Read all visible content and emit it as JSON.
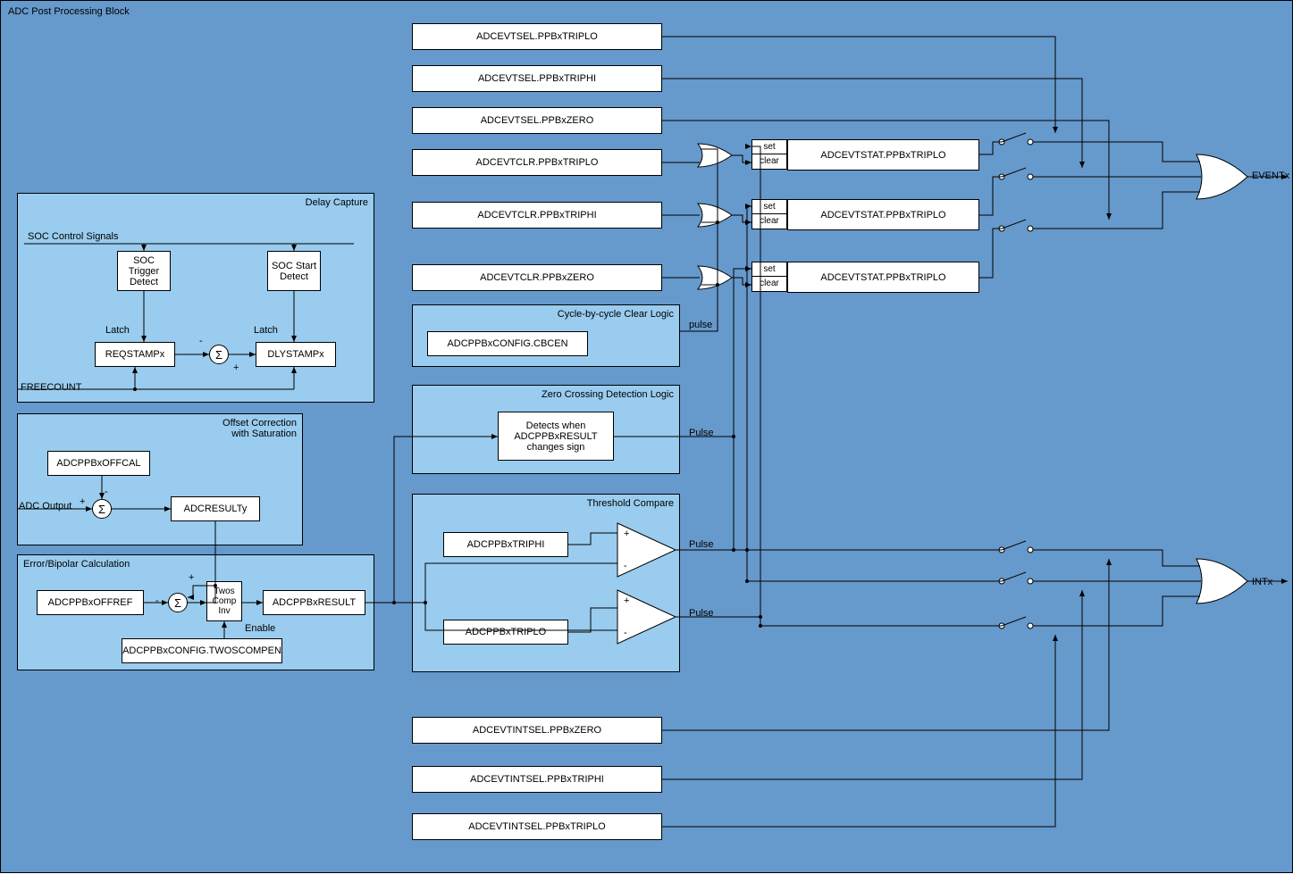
{
  "title": "ADC Post Processing Block",
  "registers": {
    "evtsel_triplo": "ADCEVTSEL.PPBxTRIPLO",
    "evtsel_triphi": "ADCEVTSEL.PPBxTRIPHI",
    "evtsel_zero": "ADCEVTSEL.PPBxZERO",
    "evtclr_triplo": "ADCEVTCLR.PPBxTRIPLO",
    "evtclr_triphi": "ADCEVTCLR.PPBxTRIPHI",
    "evtclr_zero": "ADCEVTCLR.PPBxZERO",
    "evtstat1": "ADCEVTSTAT.PPBxTRIPLO",
    "evtstat2": "ADCEVTSTAT.PPBxTRIPLO",
    "evtstat3": "ADCEVTSTAT.PPBxTRIPLO",
    "cbcen": "ADCPPBxCONFIG.CBCEN",
    "evtintsel_zero": "ADCEVTINTSEL.PPBxZERO",
    "evtintsel_triphi": "ADCEVTINTSEL.PPBxTRIPHI",
    "evtintsel_triplo": "ADCEVTINTSEL.PPBxTRIPLO"
  },
  "delay_capture": {
    "title": "Delay Capture",
    "soc_signals": "SOC Control Signals",
    "soc_trigger": "SOC Trigger Detect",
    "soc_start": "SOC Start Detect",
    "latch": "Latch",
    "reqstamp": "REQSTAMPx",
    "dlystamp": "DLYSTAMPx",
    "freecount": "FREECOUNT"
  },
  "offset_corr": {
    "title": "Offset Correction with Saturation",
    "offcal": "ADCPPBxOFFCAL",
    "adcresult": "ADCRESULTy",
    "adc_output": "ADC Output"
  },
  "error_calc": {
    "title": "Error/Bipolar Calculation",
    "offref": "ADCPPBxOFFREF",
    "twos": "Twos Comp Inv",
    "result": "ADCPPBxRESULT",
    "twoscompen": "ADCPPBxCONFIG.TWOSCOMPEN",
    "enable": "Enable"
  },
  "cycle_clear": {
    "title": "Cycle-by-cycle Clear Logic",
    "pulse": "pulse"
  },
  "zero_cross": {
    "title": "Zero Crossing Detection Logic",
    "desc": "Detects when ADCPPBxRESULT changes sign",
    "pulse": "Pulse"
  },
  "threshold": {
    "title": "Threshold Compare",
    "triphi": "ADCPPBxTRIPHI",
    "triplo": "ADCPPBxTRIPLO",
    "pulse": "Pulse"
  },
  "outputs": {
    "eventx": "EVENTx",
    "intx": "INTx"
  },
  "misc": {
    "set": "set",
    "clear": "clear",
    "plus": "+",
    "minus": "-",
    "sigma": "Σ"
  }
}
